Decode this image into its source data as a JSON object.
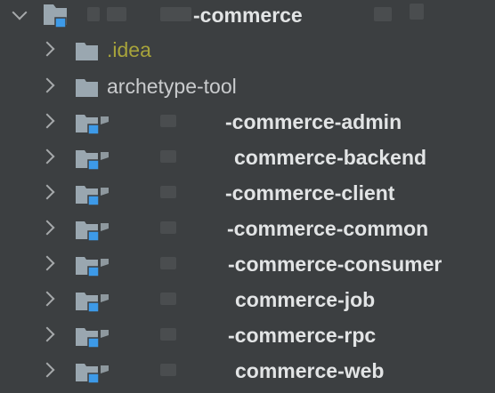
{
  "project_tree": {
    "root": {
      "name": "-commerce",
      "expanded": true,
      "icon": "module-folder-icon"
    },
    "items": [
      {
        "name": ".idea",
        "type": "folder",
        "style": "idea"
      },
      {
        "name": "archetype-tool",
        "type": "folder",
        "style": "plain"
      },
      {
        "name": "-commerce-admin",
        "type": "module",
        "style": "bold"
      },
      {
        "name": "commerce-backend",
        "type": "module",
        "style": "bold"
      },
      {
        "name": "-commerce-client",
        "type": "module",
        "style": "bold"
      },
      {
        "name": "-commerce-common",
        "type": "module",
        "style": "bold"
      },
      {
        "name": "-commerce-consumer",
        "type": "module",
        "style": "bold"
      },
      {
        "name": "commerce-job",
        "type": "module",
        "style": "bold"
      },
      {
        "name": "-commerce-rpc",
        "type": "module",
        "style": "bold"
      },
      {
        "name": "commerce-web",
        "type": "module",
        "style": "bold"
      }
    ]
  },
  "colors": {
    "background": "#3c3f41",
    "folder": "#9aa7b0",
    "module_badge": "#3d9ae8",
    "idea_text": "#a7a33b",
    "text": "#e2e4e5"
  }
}
